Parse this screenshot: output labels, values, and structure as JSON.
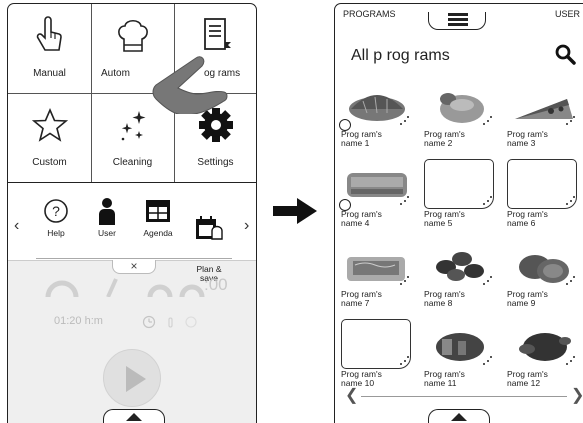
{
  "left_screen": {
    "tiles": [
      {
        "label": "Manual",
        "icon": "hand-pointer-icon"
      },
      {
        "label": "Autom",
        "icon": "chef-hat-icon"
      },
      {
        "label": "og rams",
        "icon": "recipe-book-icon"
      },
      {
        "label": "Custom",
        "icon": "star-icon"
      },
      {
        "label": "Cleaning",
        "icon": "sparkle-icon"
      },
      {
        "label": "Settings",
        "icon": "gear-icon"
      }
    ],
    "tools": [
      {
        "label": "Help",
        "icon": "question-icon"
      },
      {
        "label": "User",
        "icon": "user-icon"
      },
      {
        "label": "Agenda",
        "icon": "calendar-icon"
      },
      {
        "label": "Plan &\nsave",
        "icon": "plan-save-icon"
      }
    ],
    "close_symbol": "×",
    "timer_text": "01:20 h:m",
    "seconds_text": ":00"
  },
  "right_screen": {
    "top_left_label": "PROGRAMS",
    "top_right_label": "USER",
    "title": "All p rog rams",
    "programs": [
      {
        "name": "Prog ram's\nname 1",
        "thumb": "croissant"
      },
      {
        "name": "Prog ram's\nname 2",
        "thumb": "bread-roll"
      },
      {
        "name": "Prog ram's\nname 3",
        "thumb": "pizza-slice"
      },
      {
        "name": "Prog ram's\nname 4",
        "thumb": "lasagna"
      },
      {
        "name": "Prog ram's\nname 5",
        "thumb": "empty"
      },
      {
        "name": "Prog ram's\nname 6",
        "thumb": "empty"
      },
      {
        "name": "Prog ram's\nname 7",
        "thumb": "fish-fillet"
      },
      {
        "name": "Prog ram's\nname 8",
        "thumb": "mussels"
      },
      {
        "name": "Prog ram's\nname 9",
        "thumb": "burgers"
      },
      {
        "name": "Prog ram's\nname 10",
        "thumb": "empty"
      },
      {
        "name": "Prog ram's\nname 11",
        "thumb": "roast-meat"
      },
      {
        "name": "Prog ram's\nname 12",
        "thumb": "roast-chicken"
      }
    ]
  }
}
